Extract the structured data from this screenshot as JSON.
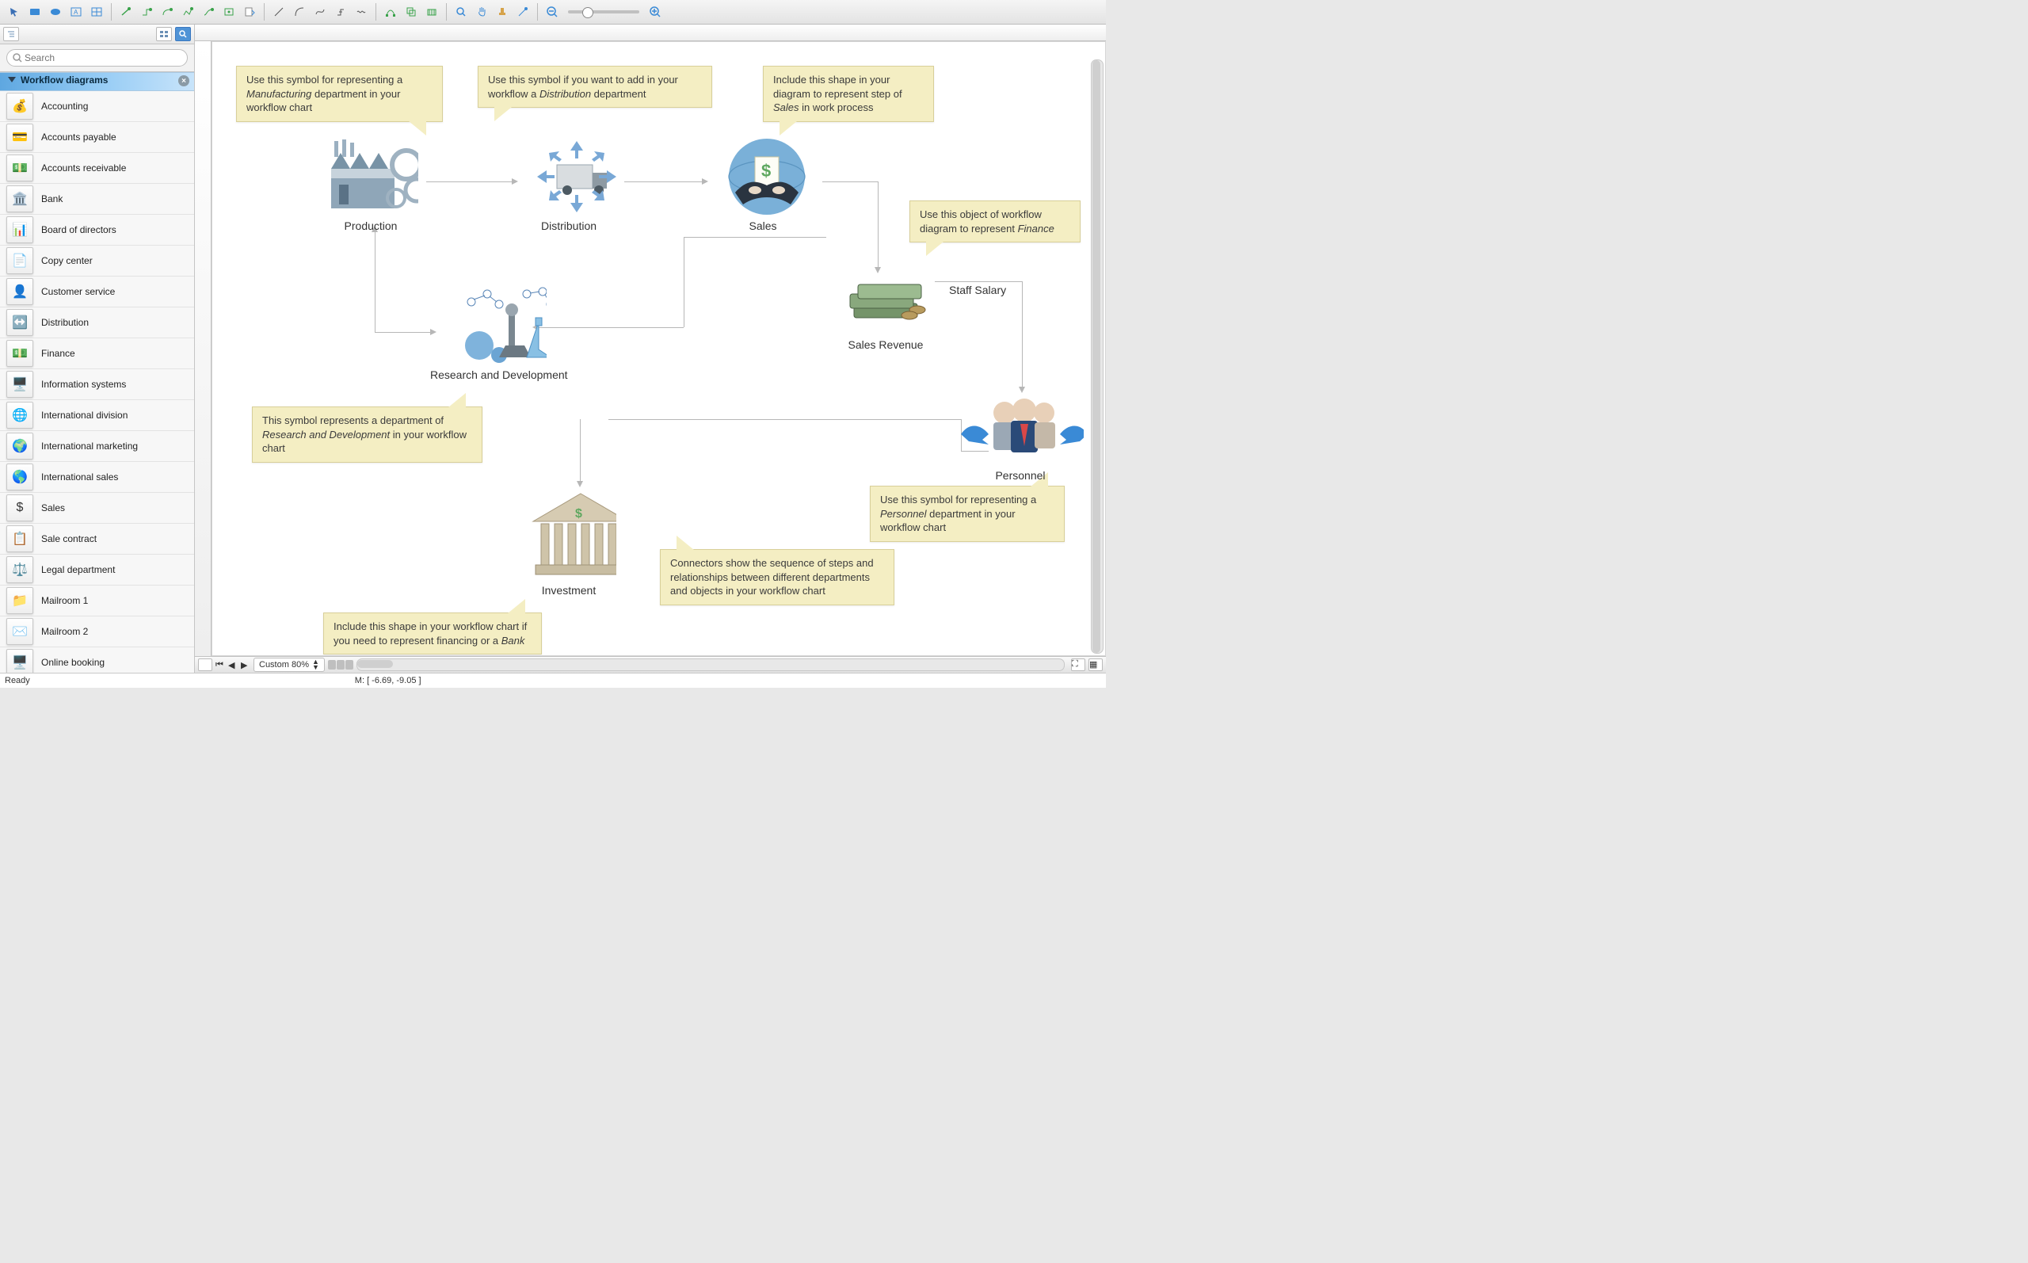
{
  "toolbar": {
    "tools": [
      "pointer",
      "rect",
      "ellipse",
      "text",
      "table",
      "connector-smart",
      "connector-direct",
      "connector-arc",
      "connector-round",
      "connector-angle",
      "connector-curve",
      "page-setup"
    ],
    "lines": [
      "line",
      "arc",
      "curve",
      "spline",
      "freehand"
    ],
    "edit": [
      "union",
      "intersect",
      "arrange"
    ],
    "view": [
      "zoom",
      "pan",
      "highlighter",
      "eyedropper"
    ],
    "zoom": [
      "zoom-out",
      "slider",
      "zoom-in"
    ]
  },
  "sidebar": {
    "search_placeholder": "Search",
    "category": "Workflow diagrams",
    "items": [
      {
        "label": "Accounting",
        "glyph": "💰"
      },
      {
        "label": "Accounts payable",
        "glyph": "💳"
      },
      {
        "label": "Accounts receivable",
        "glyph": "💵"
      },
      {
        "label": "Bank",
        "glyph": "🏛️"
      },
      {
        "label": "Board of directors",
        "glyph": "📊"
      },
      {
        "label": "Copy center",
        "glyph": "📄"
      },
      {
        "label": "Customer service",
        "glyph": "👤"
      },
      {
        "label": "Distribution",
        "glyph": "↔️"
      },
      {
        "label": "Finance",
        "glyph": "💵"
      },
      {
        "label": "Information systems",
        "glyph": "🖥️"
      },
      {
        "label": "International division",
        "glyph": "🌐"
      },
      {
        "label": "International marketing",
        "glyph": "🌍"
      },
      {
        "label": "International sales",
        "glyph": "🌎"
      },
      {
        "label": "Sales",
        "glyph": "$"
      },
      {
        "label": "Sale contract",
        "glyph": "📋"
      },
      {
        "label": "Legal department",
        "glyph": "⚖️"
      },
      {
        "label": "Mailroom 1",
        "glyph": "📁"
      },
      {
        "label": "Mailroom 2",
        "glyph": "✉️"
      },
      {
        "label": "Online booking",
        "glyph": "🖥️"
      }
    ]
  },
  "canvas": {
    "nodes": {
      "production": "Production",
      "distribution": "Distribution",
      "sales": "Sales",
      "sales_revenue": "Sales Revenue",
      "staff_salary": "Staff Salary",
      "rnd": "Research and Development",
      "personnel": "Personnel",
      "investment": "Investment"
    },
    "callouts": {
      "c_production": "Use this symbol for representing a <em>Manufacturing</em> department in your workflow chart",
      "c_distribution": "Use this symbol if you want to add in your workflow a <em>Distribution</em> department",
      "c_sales": "Include this shape in your diagram to represent step of <em>Sales</em> in work process",
      "c_finance": "Use this object of workflow diagram to represent <em>Finance</em>",
      "c_rnd": "This symbol represents a department of <em>Research and Development</em> in your workflow chart",
      "c_personnel": "Use this symbol for representing a <em>Personnel</em> department in your workflow chart",
      "c_connectors": "Connectors show the sequence of steps and relationships between different departments and objects in your workflow chart",
      "c_investment": "Include this shape in your workflow chart if you need to represent financing or a <em>Bank</em>"
    }
  },
  "bottombar": {
    "zoom_label": "Custom 80%"
  },
  "statusbar": {
    "ready": "Ready",
    "mouse": "M: [ -6.69, -9.05 ]"
  }
}
